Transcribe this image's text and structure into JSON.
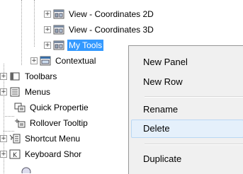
{
  "tree": {
    "items": [
      {
        "label": "View - Coordinates 2D",
        "expander": "+",
        "icon": "workspace-view-icon"
      },
      {
        "label": "View - Coordinates 3D",
        "expander": "+",
        "icon": "workspace-view-icon"
      },
      {
        "label": "My Tools",
        "expander": "+",
        "icon": "workspace-view-icon",
        "selected": true
      },
      {
        "label": "Contextual",
        "expander": "+",
        "icon": "contextual-tab-icon"
      },
      {
        "label": "Toolbars",
        "expander": "+",
        "icon": "toolbars-icon"
      },
      {
        "label": "Menus",
        "expander": "+",
        "icon": "menus-icon"
      },
      {
        "label": "Quick Propertie",
        "expander": "",
        "icon": "quick-properties-icon"
      },
      {
        "label": "Rollover Tooltip",
        "expander": "",
        "icon": "rollover-tooltip-icon"
      },
      {
        "label": "Shortcut Menu",
        "expander": "+",
        "icon": "shortcut-menu-icon"
      },
      {
        "label": "Keyboard Shor",
        "expander": "+",
        "icon": "keyboard-shortcut-icon"
      }
    ]
  },
  "context_menu": {
    "items": [
      "New Panel",
      "New Row",
      "Rename",
      "Delete",
      "Duplicate"
    ],
    "highlighted": "Delete"
  },
  "colors": {
    "selection": "#3399ff",
    "menu_background": "#f0f0f0",
    "menu_hover": "#e5f0fb"
  }
}
